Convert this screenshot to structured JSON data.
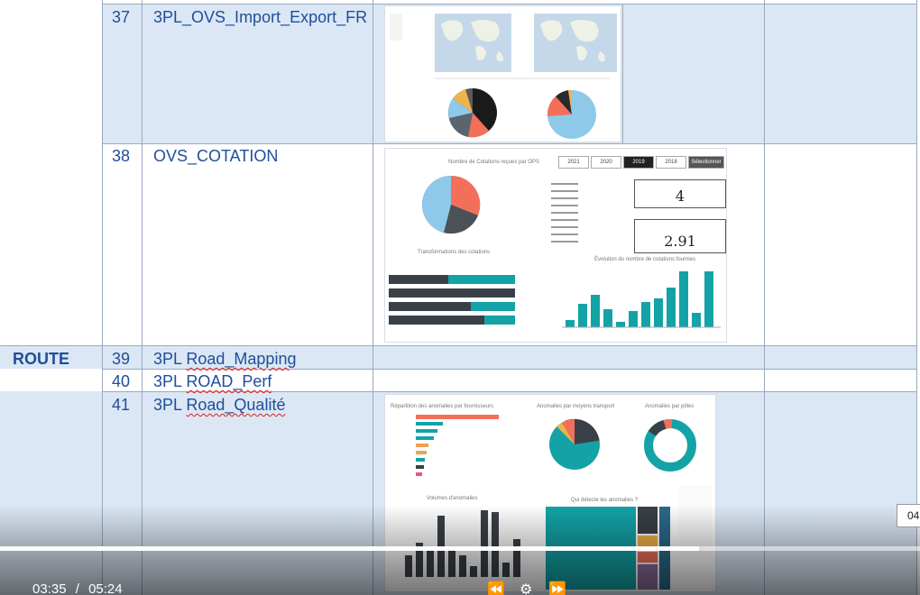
{
  "rows": [
    {
      "number": "37",
      "name": "3PL_OVS_Import_Export_FR"
    },
    {
      "number": "38",
      "name": "OVS_COTATION"
    },
    {
      "number": "39",
      "name_prefix": "3PL ",
      "name_underlined": "Road_Mapping"
    },
    {
      "number": "40",
      "name_prefix": "3PL ",
      "name_underlined": "ROAD_Perf"
    },
    {
      "number": "41",
      "name_prefix": "3PL ",
      "name_underlined": "Road_Qualité"
    }
  ],
  "section_label": "ROUTE",
  "thumbnails": {
    "cotation": {
      "pie_title": "Nombre de Cotations reçues par OPS",
      "bars_title": "Transformations des cotations",
      "evolution_title": "Évolution du nombre de cotations fournies",
      "kpi1_value": "4",
      "kpi2_value": "2.91",
      "tabs": [
        "Sélectionner tout",
        "2018",
        "2019",
        "2020",
        "2021"
      ]
    },
    "qualite": {
      "title1": "Répartition des anomalies par fournisseurs",
      "title2": "Anomalies par moyens transport",
      "title3": "Anomalies par pôles",
      "title4": "Volumes d'anomalies",
      "title5": "Qui détecte les anomalies ?"
    }
  },
  "colors": {
    "table_blue": "#dbe7f5",
    "text_blue": "#1f4e9a",
    "teal": "#13a3a7",
    "dark": "#3a4047",
    "salmon": "#f2705a"
  },
  "player": {
    "current_time": "03:35",
    "separator": "/",
    "duration": "05:24",
    "progress_fraction": 0.76,
    "tooltip_time": "04:",
    "controls": [
      "rewind-icon",
      "settings-icon",
      "fast-forward-icon"
    ]
  }
}
